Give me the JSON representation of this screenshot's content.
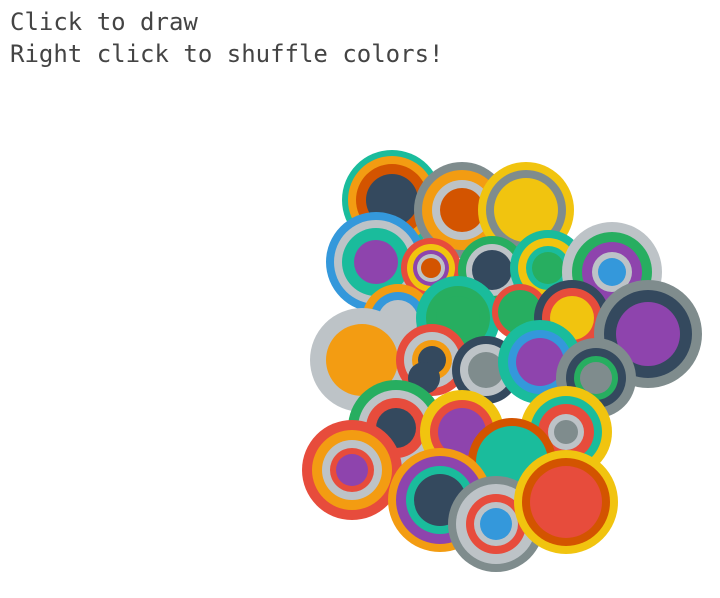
{
  "instructions": {
    "line1": "Click to draw",
    "line2": "Right click to shuffle colors!"
  },
  "palette": {
    "turquoise": "#1abc9c",
    "green": "#27ae60",
    "blue": "#3498db",
    "purple": "#8e44ad",
    "navy": "#34495e",
    "yellow": "#f1c40f",
    "orange": "#f39c12",
    "pumpkin": "#d35400",
    "red": "#e74c3c",
    "silver": "#bdc3c7",
    "gray": "#7f8c8d",
    "white": "#ecf0f1"
  }
}
